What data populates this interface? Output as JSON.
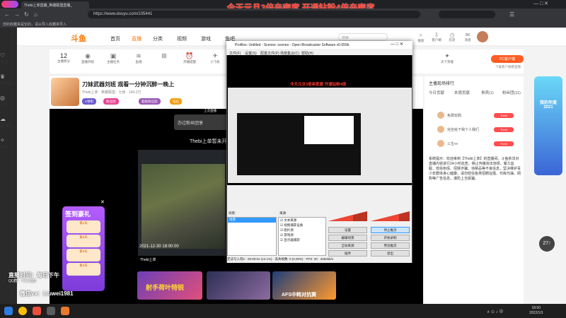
{
  "browser": {
    "tab_title": "Thebi上单直播_英雄联盟直播_",
    "url": "https://www.douyu.com/105441",
    "bookmarks": "您的收藏夹是空的，请从导入收藏夹导入",
    "banner_text": "今天元旦3倍亲密度 开通钻粉4倍亲密度"
  },
  "left_rail": {
    "items": [
      {
        "label": "关注",
        "icon": "heart-icon"
      },
      {
        "label": "排行榜",
        "icon": "trophy-icon"
      },
      {
        "label": "游戏",
        "icon": "gamepad-icon"
      },
      {
        "label": "云游戏",
        "icon": "cloud-icon"
      },
      {
        "label": "漫游",
        "icon": "compass-icon"
      }
    ]
  },
  "header": {
    "logo": "斗鱼",
    "nav": [
      "首页",
      "直播",
      "分类",
      "视频",
      "游戏",
      "鱼吧"
    ],
    "search_placeholder": "搜索",
    "icons": [
      {
        "label": "搜索",
        "icon": "search-icon"
      },
      {
        "label": "客户端",
        "icon": "download-icon"
      },
      {
        "label": "历史",
        "icon": "history-icon"
      },
      {
        "label": "消息",
        "icon": "message-icon"
      },
      {
        "label": "创作中心",
        "icon": "create-icon"
      }
    ]
  },
  "stats": [
    {
      "value": "12",
      "label": "主播积分"
    },
    {
      "label": "直播开始",
      "icon": "record-icon"
    },
    {
      "label": "主播任务",
      "icon": "task-icon"
    },
    {
      "label": "鱼塘",
      "icon": "pond-icon"
    },
    {
      "label": "开播提醒",
      "icon": "alarm-icon"
    },
    {
      "label": "小飞机",
      "icon": "plane-icon"
    },
    {
      "label": "天下英雄",
      "icon": "hero-icon"
    }
  ],
  "pc_button": "PC客户端",
  "client_text": "下载客户端看直播",
  "room": {
    "title": "刀妹武器刘班 观看一分钟沉醉一晚上",
    "meta": "Thebi上单 · 英雄联盟 · 七级 · 144.2万",
    "chips": [
      "V领衔",
      "粉丝团",
      "超级粉丝团",
      "钻石"
    ]
  },
  "video": {
    "live_label": "上次直播",
    "ticker": "办过粉丝团享",
    "streamer_text": "Thebi上单暂未开",
    "timestamp": "2021-12-30 18:00:00",
    "streamer_name": "Thebi上单"
  },
  "checkin": {
    "title": "签到豪礼",
    "items": [
      "第1天",
      "第2天",
      "第3天",
      "第4天"
    ]
  },
  "overlay": {
    "time_line": "直播时间：每日下午",
    "qq_line": "QQ群：ThebiQ群",
    "vx_line": "微信vx：Liuwei1981"
  },
  "thumbs": {
    "t1": "射手荷叶特锐",
    "t3": "AFS中韩对抗赛"
  },
  "chat": {
    "tabs": [
      "今日贡献",
      "本周贡献",
      "贵宾(1)",
      "粉丝团(11)"
    ],
    "rank_title": "主播现场排行",
    "ranks": [
      {
        "name": "免费玩鸦",
        "badge": "Thebi"
      },
      {
        "name": "完全给下我个人我们",
        "badge": "Thebi"
      },
      {
        "name": "三生vv",
        "badge": "Thebi"
      }
    ],
    "system_msg": "系统提示：欢迎来到【Thebi上单】的直播间。斗鱼依法对直播内容进行24小时巡查，禁止传播违法违规、暴力血腥、低俗色情、招嫖诈骗、违禁品等不良信息，坚决维护青少年群体身心健康。请勿轻信各类招聘征婚、代练代抽、网购等广告信息，谨防上当受骗。"
  },
  "promo_right": {
    "title": "我的年度2021"
  },
  "float_bubble": "27↑",
  "obs": {
    "title": "Profiles: Untitled - Scenes: scenes - Open Broadcaster Software v0.659b",
    "menu": [
      "文件(F)",
      "设置(S)",
      "配置文件(P)",
      "场景集合(C)",
      "帮助(H)"
    ],
    "scenes_label": "场景:",
    "sources_label": "来源:",
    "scene_item": "场景",
    "sources": [
      "文本来源",
      "视频捕获设备",
      "图片源",
      "游戏源",
      "显示器捕获"
    ],
    "buttons": [
      "设置",
      "停止推流",
      "编辑场景",
      "开始录制",
      "全局来源",
      "预览推流",
      "插件",
      "退出"
    ],
    "status": "无法写入到2 · 00:00:01 (12.1%) · 丢失帧数: 0 (0.00%) · FPS: 30 · 2084kb/s",
    "banner": "今天元旦3倍亲密度 开通钻粉4倍"
  },
  "taskbar": {
    "time": "18:50",
    "date": "2022/1/3"
  },
  "colors": {
    "brand_orange": "#ff7700",
    "banner_red": "#ff3b2f",
    "checkin_purple": "#7d3bd9"
  }
}
